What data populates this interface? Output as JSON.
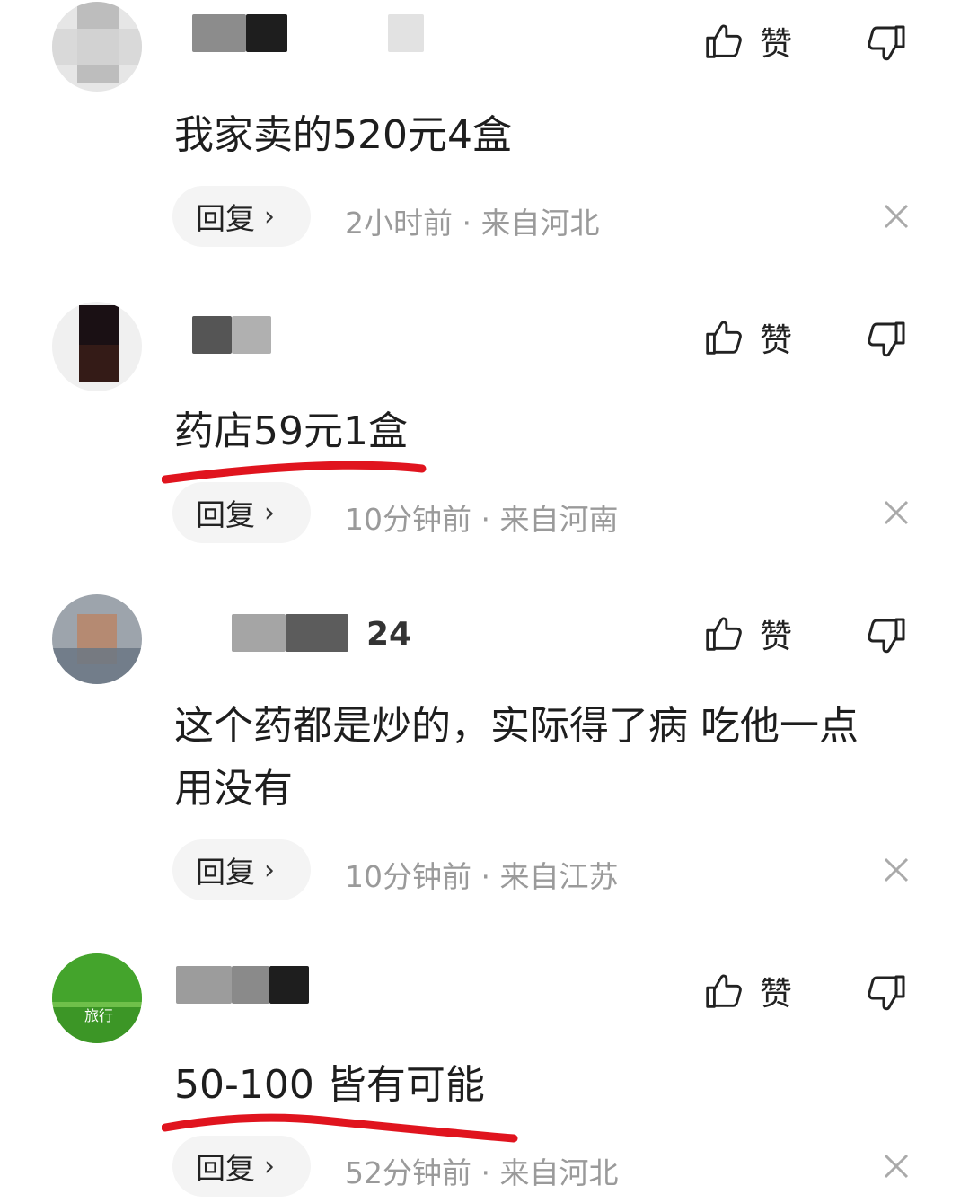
{
  "comments": [
    {
      "username_suffix": "",
      "like_label": "赞",
      "text": "我家卖的520元4盒",
      "reply_label": "回复",
      "time": "2小时前",
      "location": "来自河北"
    },
    {
      "username_suffix": "",
      "like_label": "赞",
      "text": "药店59元1盒",
      "reply_label": "回复",
      "time": "10分钟前",
      "location": "来自河南"
    },
    {
      "username_suffix": "24",
      "like_label": "赞",
      "text": "这个药都是炒的，实际得了病 吃他一点用没有",
      "reply_label": "回复",
      "time": "10分钟前",
      "location": "来自江苏"
    },
    {
      "username_suffix": "",
      "avatar_text": "旅行",
      "like_label": "赞",
      "text": "50-100 皆有可能",
      "reply_label": "回复",
      "time": "52分钟前",
      "location": "来自河北"
    }
  ],
  "meta_separator": " · ",
  "icons": {
    "like": "thumbs-up-icon",
    "dislike": "thumbs-down-icon",
    "close": "close-icon",
    "reply_arrow": "chevron-right-icon"
  },
  "colors": {
    "annotation_red": "#e0141e",
    "meta_gray": "#9a9a9a",
    "reply_bg": "#f4f4f4"
  }
}
